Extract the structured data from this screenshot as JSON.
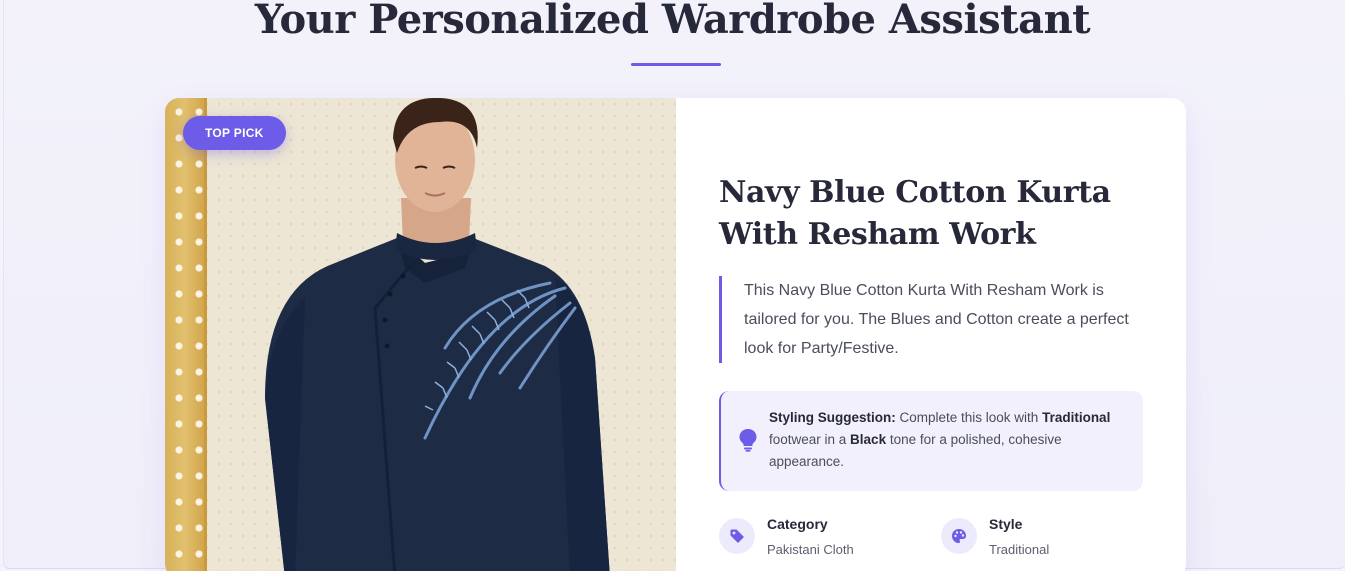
{
  "page": {
    "title": "Your Personalized Wardrobe Assistant",
    "accent_color": "#6c5ce7"
  },
  "product": {
    "badge": "TOP PICK",
    "image_alt": "Navy blue cotton kurta with resham embroidery",
    "title": "Navy Blue Cotton Kurta With Resham Work",
    "description": "This Navy Blue Cotton Kurta With Resham Work is tailored for you. The Blues and Cotton create a perfect look for Party/Festive."
  },
  "suggestion": {
    "icon": "lightbulb-icon",
    "label": "Styling Suggestion:",
    "text_1": " Complete this look with ",
    "bold_1": "Traditional",
    "text_2": " footwear in a ",
    "bold_2": "Black",
    "text_3": " tone for a polished, cohesive appearance."
  },
  "meta": [
    {
      "icon": "tag-icon",
      "label": "Category",
      "value": "Pakistani Cloth"
    },
    {
      "icon": "palette-icon",
      "label": "Style",
      "value": "Traditional"
    }
  ]
}
